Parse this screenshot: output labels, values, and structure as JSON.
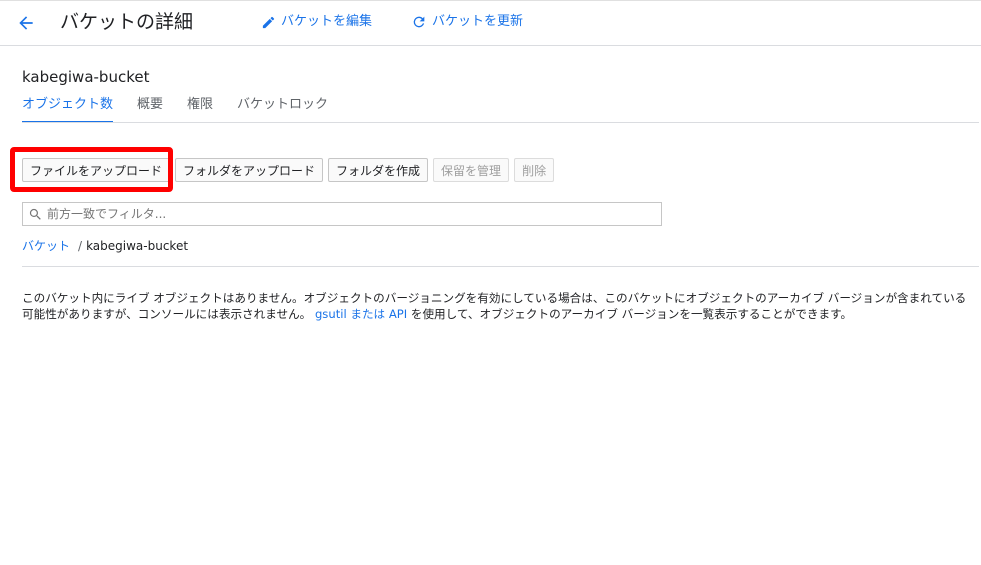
{
  "header": {
    "back_icon": "arrow-left-icon",
    "title": "バケットの詳細",
    "edit_icon": "pencil-icon",
    "edit_label": "バケットを編集",
    "refresh_icon": "refresh-icon",
    "refresh_label": "バケットを更新"
  },
  "bucket": {
    "name": "kabegiwa-bucket"
  },
  "tabs": [
    {
      "label": "オブジェクト数",
      "active": true
    },
    {
      "label": "概要",
      "active": false
    },
    {
      "label": "権限",
      "active": false
    },
    {
      "label": "バケットロック",
      "active": false
    }
  ],
  "toolbar": {
    "upload_files": "ファイルをアップロード",
    "upload_folder": "フォルダをアップロード",
    "create_folder": "フォルダを作成",
    "manage_holds": "保留を管理",
    "delete": "削除"
  },
  "filter": {
    "icon": "search-icon",
    "placeholder": "前方一致でフィルタ..."
  },
  "breadcrumb": {
    "root": "バケット",
    "separator": "/",
    "current": "kabegiwa-bucket"
  },
  "info": {
    "text_before": "このバケット内にライブ オブジェクトはありません。オブジェクトのバージョニングを有効にしている場合は、このバケットにオブジェクトのアーカイブ バージョンが含まれている可能性がありますが、コンソールには表示されません。 ",
    "link": "gsutil または API",
    "text_after": " を使用して、オブジェクトのアーカイブ バージョンを一覧表示することができます。"
  },
  "colors": {
    "accent": "#1a73e8",
    "highlight": "#ff0000",
    "divider": "#dadce0"
  }
}
